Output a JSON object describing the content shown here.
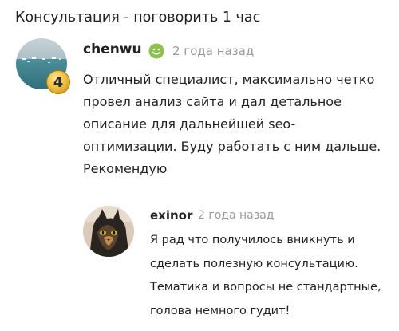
{
  "page": {
    "title": "Консультация - поговорить 1 час"
  },
  "review": {
    "author": "chenwu",
    "author_status_icon": "smile-icon",
    "level": "4",
    "time": "2 года назад",
    "text_lines": [
      "Отличный специалист, максимально четко",
      "провел анализ сайта и дал детальное",
      "описание для дальнейшей seo-",
      "оптимизации. Буду работать с ним дальше.",
      "Рекомендую"
    ]
  },
  "reply": {
    "author": "exinor",
    "time": "2 года назад",
    "text_lines": [
      "Я рад что получилось вникнуть и",
      "сделать полезную консультацию.",
      "Тематика и вопросы не стандартные,",
      "голова немного гудит!"
    ]
  },
  "colors": {
    "text": "#222222",
    "muted": "#9a9a9a",
    "online_green": "#8bc34a",
    "badge_gold": "#f0c040"
  }
}
